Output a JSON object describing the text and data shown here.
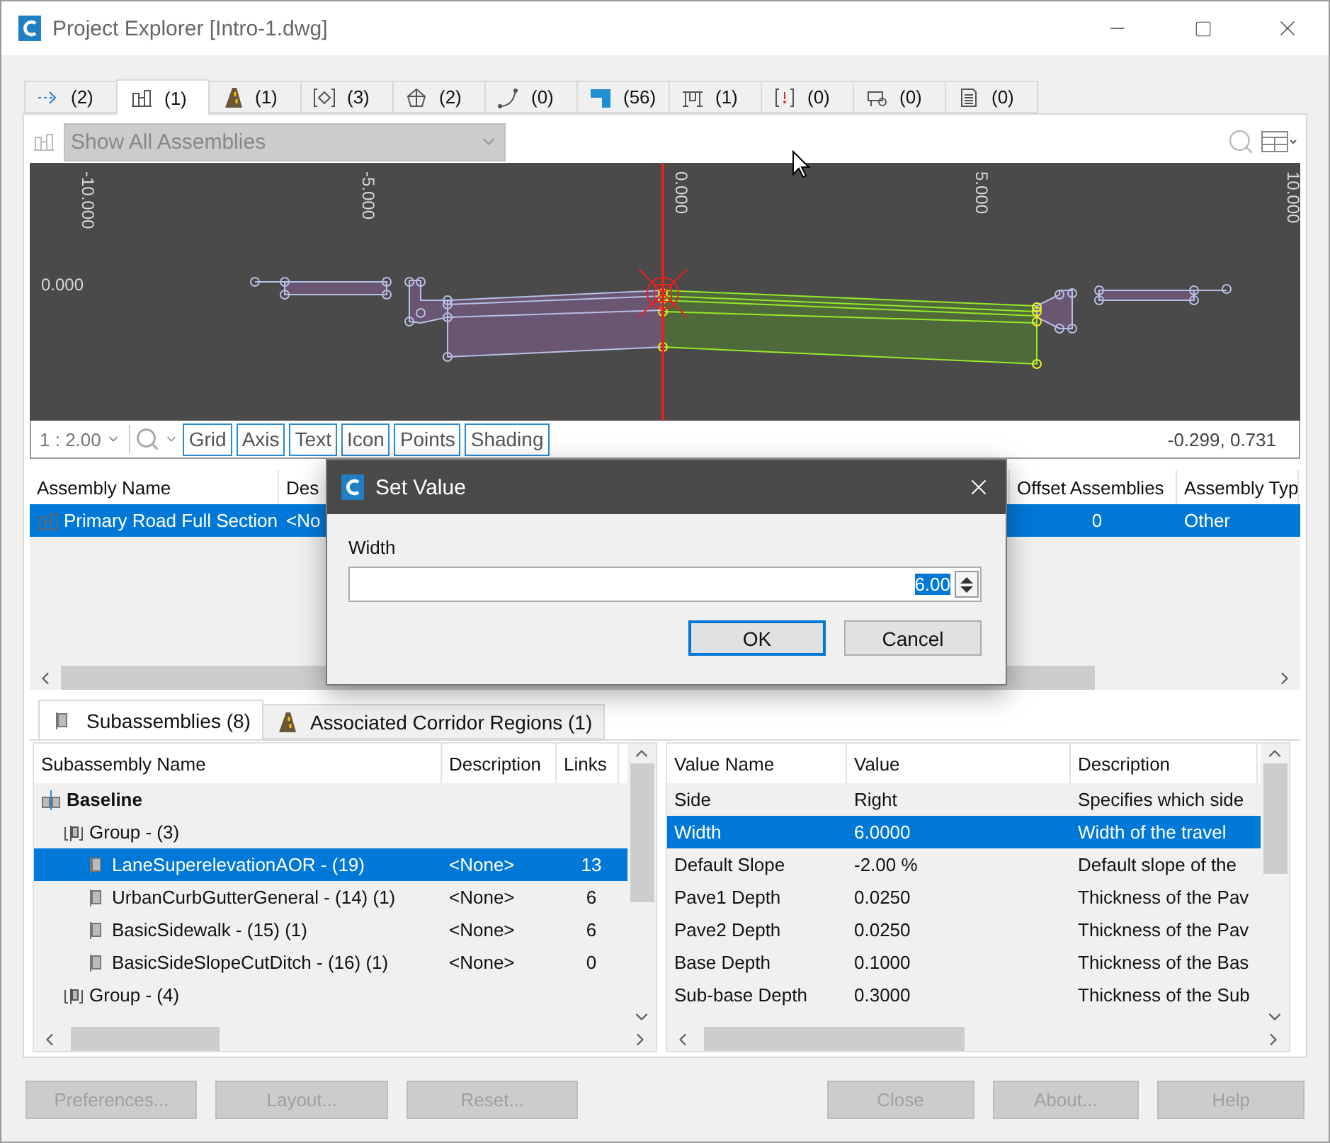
{
  "window": {
    "title": "Project Explorer [Intro-1.dwg]"
  },
  "tabs": [
    {
      "label": "(2)",
      "selected": false
    },
    {
      "label": "(1)",
      "selected": true
    },
    {
      "label": "(1)",
      "selected": false
    },
    {
      "label": "(3)",
      "selected": false
    },
    {
      "label": "(2)",
      "selected": false
    },
    {
      "label": "(0)",
      "selected": false
    },
    {
      "label": "(56)",
      "selected": false
    },
    {
      "label": "(1)",
      "selected": false
    },
    {
      "label": "(0)",
      "selected": false
    },
    {
      "label": "(0)",
      "selected": false
    },
    {
      "label": "(0)",
      "selected": false
    }
  ],
  "toolbar": {
    "filter": "Show All Assemblies"
  },
  "viewport": {
    "x_axis_labels": [
      "-10.000",
      "-5.000",
      "0.000",
      "5.000",
      "10.000"
    ],
    "y_axis_label": "0.000",
    "scale": "1 : 2.00",
    "toggles": [
      {
        "label": "Grid",
        "on": true
      },
      {
        "label": "Axis",
        "on": true
      },
      {
        "label": "Text",
        "on": true
      },
      {
        "label": "Icon",
        "on": true
      },
      {
        "label": "Points",
        "on": true
      },
      {
        "label": "Shading",
        "on": true
      }
    ],
    "coordinates": "-0.299, 0.731"
  },
  "assemblies": {
    "columns": [
      "Assembly Name",
      "Des",
      "Offset Assemblies",
      "Assembly Typ"
    ],
    "rows": [
      {
        "cells": [
          "Primary Road Full Section",
          "<No",
          "0",
          "Other"
        ],
        "selected": true
      }
    ]
  },
  "dialog": {
    "title": "Set Value",
    "field_label": "Width",
    "value": "6.00",
    "buttons": [
      "OK",
      "Cancel"
    ]
  },
  "lower_tabs": [
    {
      "label": "Subassemblies (8)",
      "selected": true
    },
    {
      "label": "Associated Corridor Regions (1)",
      "selected": false
    }
  ],
  "subassemblies": {
    "columns": [
      "Subassembly Name",
      "Description",
      "Links"
    ],
    "tree": [
      {
        "kind": "baseline",
        "name": "Baseline",
        "children": [
          {
            "kind": "group",
            "name": "Group - (3)",
            "children": [
              {
                "kind": "subassembly",
                "name": "LaneSuperelevationAOR - (19)",
                "description": "<None>",
                "links": "13",
                "selected": true
              },
              {
                "kind": "subassembly",
                "name": "UrbanCurbGutterGeneral - (14) (1)",
                "description": "<None>",
                "links": "6",
                "selected": false
              },
              {
                "kind": "subassembly",
                "name": "BasicSidewalk - (15) (1)",
                "description": "<None>",
                "links": "6",
                "selected": false
              },
              {
                "kind": "subassembly",
                "name": "BasicSideSlopeCutDitch - (16) (1)",
                "description": "<None>",
                "links": "0",
                "selected": false
              }
            ]
          },
          {
            "kind": "group",
            "name": "Group - (4)"
          }
        ]
      }
    ]
  },
  "values": {
    "columns": [
      "Value Name",
      "Value",
      "Description"
    ],
    "rows": [
      {
        "cells": [
          "Side",
          "Right",
          "Specifies which side"
        ],
        "selected": false
      },
      {
        "cells": [
          "Width",
          "6.0000",
          "Width of the travel"
        ],
        "selected": true
      },
      {
        "cells": [
          "Default Slope",
          "-2.00 %",
          "Default slope of the"
        ],
        "selected": false
      },
      {
        "cells": [
          "Pave1 Depth",
          "0.0250",
          "Thickness of the Pav"
        ],
        "selected": false
      },
      {
        "cells": [
          "Pave2 Depth",
          "0.0250",
          "Thickness of the Pav"
        ],
        "selected": false
      },
      {
        "cells": [
          "Base Depth",
          "0.1000",
          "Thickness of the Bas"
        ],
        "selected": false
      },
      {
        "cells": [
          "Sub-base Depth",
          "0.3000",
          "Thickness of the Sub"
        ],
        "selected": false
      }
    ]
  },
  "footer_buttons": [
    {
      "label": "Preferences...",
      "disabled": true
    },
    {
      "label": "Layout...",
      "disabled": true
    },
    {
      "label": "Reset...",
      "disabled": true
    },
    {
      "label": "Close",
      "disabled": true
    },
    {
      "label": "About...",
      "disabled": true
    },
    {
      "label": "Help",
      "disabled": true
    }
  ]
}
